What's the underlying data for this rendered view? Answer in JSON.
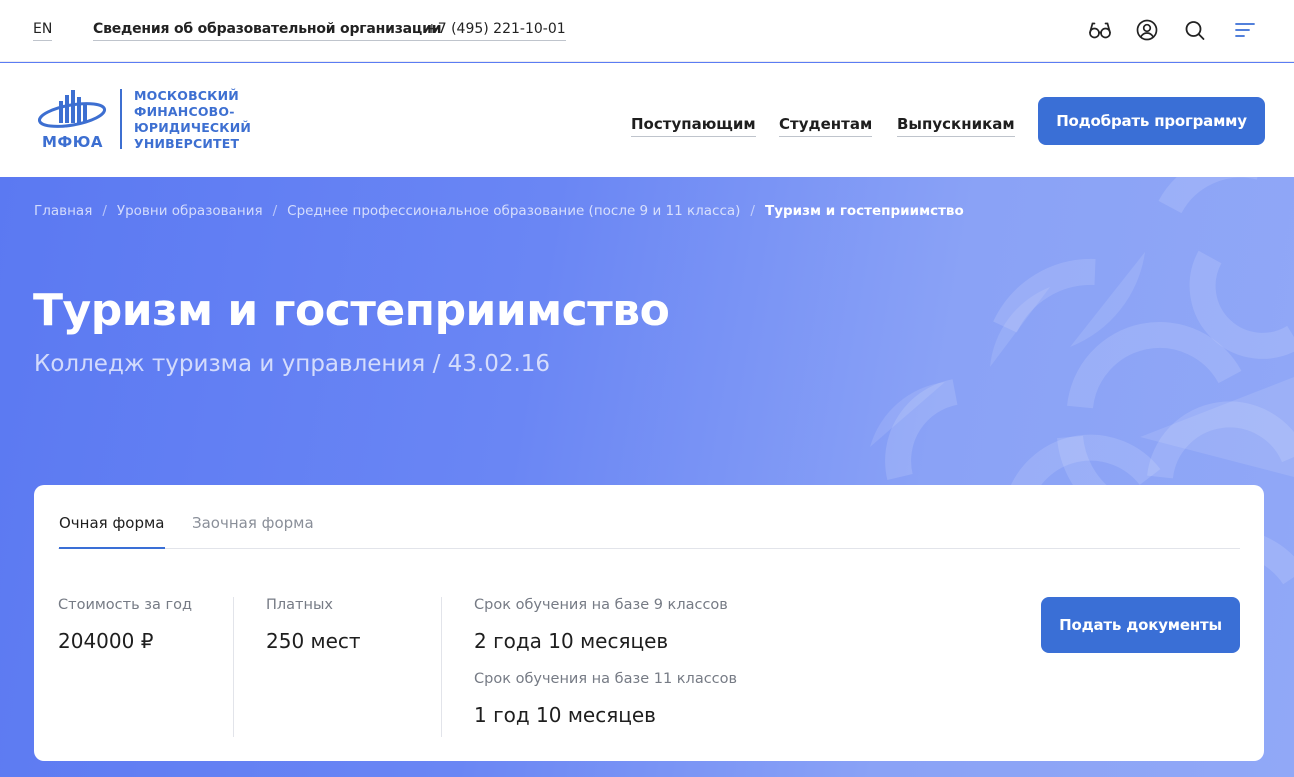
{
  "topbar": {
    "lang": "EN",
    "info_link": "Сведения об образовательной организации",
    "phone": "+7 (495) 221-10-01",
    "icons": [
      "glasses-icon",
      "user-icon",
      "search-icon",
      "menu-icon"
    ]
  },
  "header": {
    "logo": {
      "abbr": "МФЮА",
      "line1": "МОСКОВСКИЙ",
      "line2": "ФИНАНСОВО-",
      "line3": "ЮРИДИЧЕСКИЙ",
      "line4": "УНИВЕРСИТЕТ"
    },
    "nav": [
      "Поступающим",
      "Студентам",
      "Выпускникам"
    ],
    "pick_button": "Подобрать программу"
  },
  "breadcrumbs": [
    "Главная",
    "Уровни образования",
    "Среднее профессиональное образование (после 9 и 11 класса)",
    "Туризм и гостеприимство"
  ],
  "page": {
    "title": "Туризм и гостеприимство",
    "subtitle": "Колледж туризма и управления / 43.02.16"
  },
  "card": {
    "tabs": [
      {
        "label": "Очная форма",
        "active": true
      },
      {
        "label": "Заочная форма",
        "active": false
      }
    ],
    "cost_label": "Стоимость за год",
    "cost_value": "204000 ₽",
    "paid_label": "Платных",
    "paid_value": "250 мест",
    "term9_label": "Срок обучения на базе 9 классов",
    "term9_value": "2 года 10 месяцев",
    "term11_label": "Срок обучения на базе 11 классов",
    "term11_value": "1 год 10 месяцев",
    "submit_button": "Подать документы"
  },
  "colors": {
    "accent": "#3a6fd6",
    "hero_bg": "#5b79f2",
    "logo_blue": "#3d6fd1"
  }
}
